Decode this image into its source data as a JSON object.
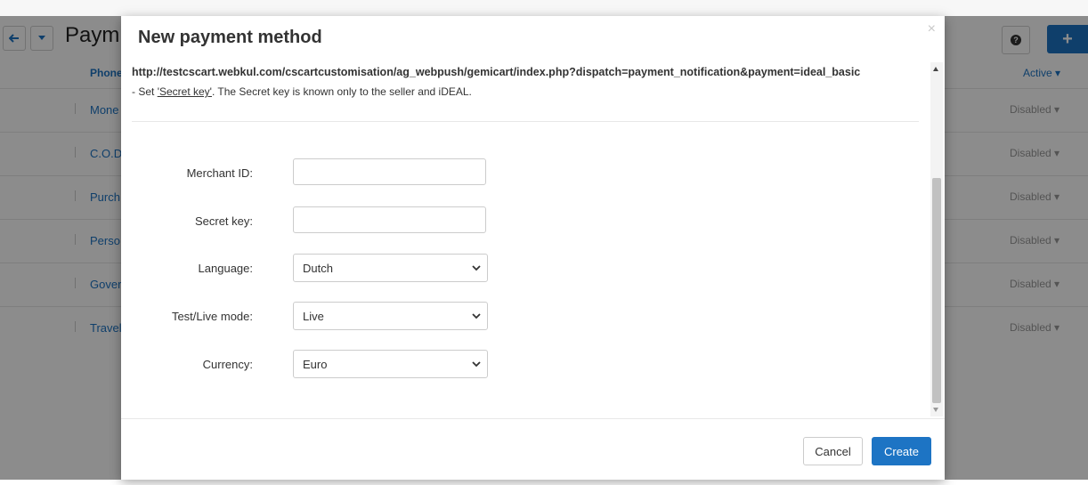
{
  "background": {
    "page_title": "Paym",
    "table_header": {
      "name": "Phone",
      "status": "Active ▾"
    },
    "rows": [
      {
        "name": "Mone",
        "status": "Disabled ▾"
      },
      {
        "name": "C.O.D",
        "status": "Disabled ▾"
      },
      {
        "name": "Purch",
        "status": "Disabled ▾"
      },
      {
        "name": "Perso",
        "status": "Disabled ▾"
      },
      {
        "name": "Gover",
        "status": "Disabled ▾"
      },
      {
        "name": "Travel",
        "status": "Disabled ▾"
      }
    ],
    "help_label": "?",
    "add_label": "+"
  },
  "modal": {
    "title": "New payment method",
    "close_label": "×",
    "url_text": "http://testcscart.webkul.com/cscartcustomisation/ag_webpush/gemicart/index.php?dispatch=payment_notification&payment=ideal_basic",
    "note": {
      "prefix": "- Set ",
      "link": "'Secret key'",
      "suffix": ". The Secret key is known only to the seller and iDEAL."
    },
    "fields": {
      "merchant_id": {
        "label": "Merchant ID:",
        "value": ""
      },
      "secret_key": {
        "label": "Secret key:",
        "value": ""
      },
      "language": {
        "label": "Language:",
        "value": "Dutch"
      },
      "mode": {
        "label": "Test/Live mode:",
        "value": "Live"
      },
      "currency": {
        "label": "Currency:",
        "value": "Euro"
      }
    },
    "buttons": {
      "cancel": "Cancel",
      "create": "Create"
    }
  },
  "colors": {
    "accent": "#1d74c4",
    "overlay": "rgba(0,0,0,0.45)"
  }
}
